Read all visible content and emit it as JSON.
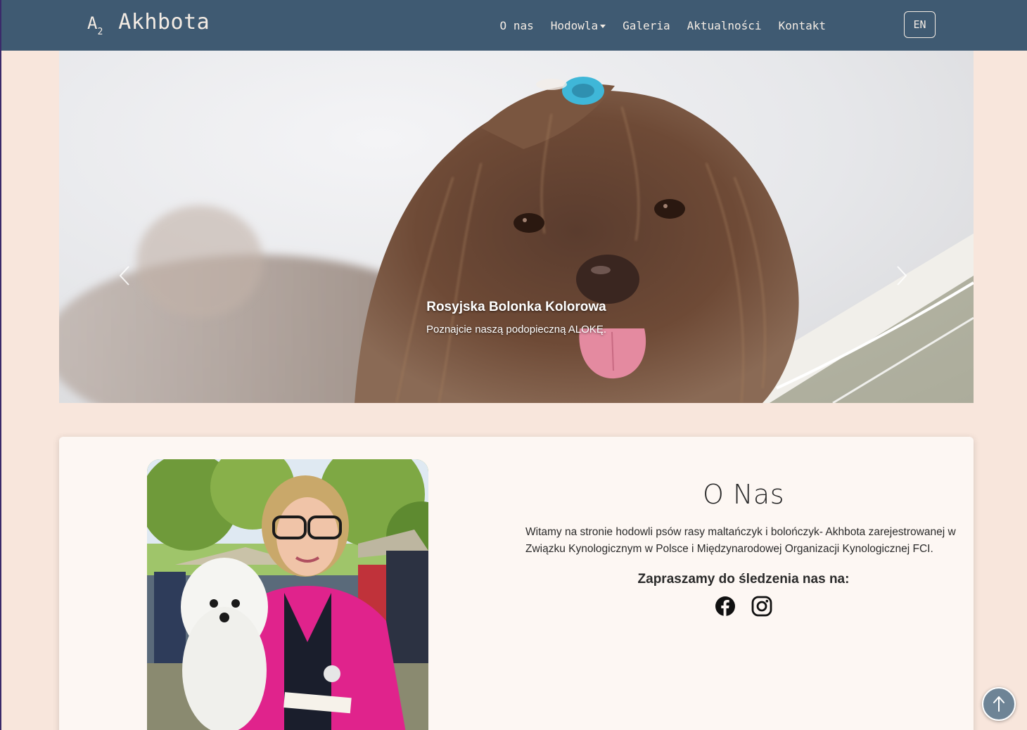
{
  "brand": {
    "logo": "A",
    "logo_sub": "2",
    "name": "Akhbota"
  },
  "nav": {
    "items": [
      {
        "label": "O nas"
      },
      {
        "label": "Hodowla",
        "dropdown": true
      },
      {
        "label": "Galeria"
      },
      {
        "label": "Aktualności"
      },
      {
        "label": "Kontakt"
      }
    ],
    "lang": "EN"
  },
  "carousel": {
    "caption_title": "Rosyjska Bolonka Kolorowa",
    "caption_text": "Poznajcie naszą podopieczną ALOKĘ."
  },
  "about": {
    "title": "O Nas",
    "body": "Witamy na stronie hodowli psów rasy maltańczyk i bolończyk- Akhbota zarejestrowanej w Związku Kynologicznym w Polsce i Międzynarodowej Organizacji Kynologicznej FCI.",
    "follow": "Zapraszamy do śledzenia nas na:",
    "socials": [
      "facebook-icon",
      "instagram-icon"
    ]
  },
  "colors": {
    "navbar": "#3f5a72",
    "page_bg": "#f8e6dc",
    "card_bg": "#fdf7f3",
    "accent_pink": "#e0238c"
  }
}
